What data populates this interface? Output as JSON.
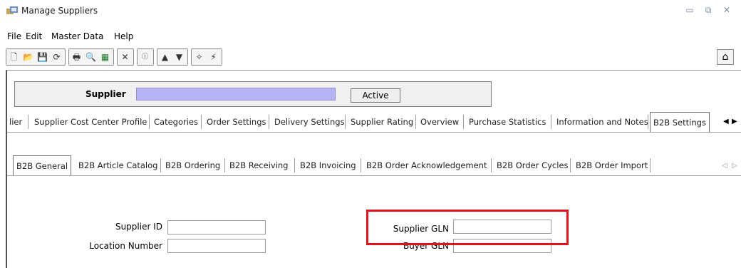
{
  "window": {
    "title": "Manage Suppliers"
  },
  "menu": {
    "items": [
      {
        "label": "File"
      },
      {
        "label": "Edit"
      },
      {
        "label": "Master Data"
      },
      {
        "label": "Help"
      }
    ]
  },
  "supplier": {
    "label": "Supplier",
    "value": "",
    "active_label": "Active"
  },
  "tabs_primary": [
    {
      "label": "lier"
    },
    {
      "label": "Supplier Cost Center Profile"
    },
    {
      "label": "Categories"
    },
    {
      "label": "Order Settings"
    },
    {
      "label": "Delivery Settings"
    },
    {
      "label": "Supplier Rating"
    },
    {
      "label": "Overview"
    },
    {
      "label": "Purchase Statistics"
    },
    {
      "label": "Information and Notes"
    },
    {
      "label": "B2B Settings",
      "active": true
    }
  ],
  "tabs_b2b": [
    {
      "label": "B2B General",
      "active": true
    },
    {
      "label": "B2B Article Catalog"
    },
    {
      "label": "B2B Ordering"
    },
    {
      "label": "B2B Receiving"
    },
    {
      "label": "B2B Invoicing"
    },
    {
      "label": "B2B Order Acknowledgement"
    },
    {
      "label": "B2B Order Cycles"
    },
    {
      "label": "B2B Order Import"
    }
  ],
  "form": {
    "supplier_id_label": "Supplier ID",
    "supplier_id_value": "",
    "location_number_label": "Location Number",
    "location_number_value": "",
    "supplier_gln_label": "Supplier GLN",
    "supplier_gln_value": "",
    "buyer_gln_label": "Buyer GLN",
    "buyer_gln_value": ""
  },
  "colors": {
    "supplier_field": "#b8b4f4",
    "highlight": "#e0121c"
  }
}
